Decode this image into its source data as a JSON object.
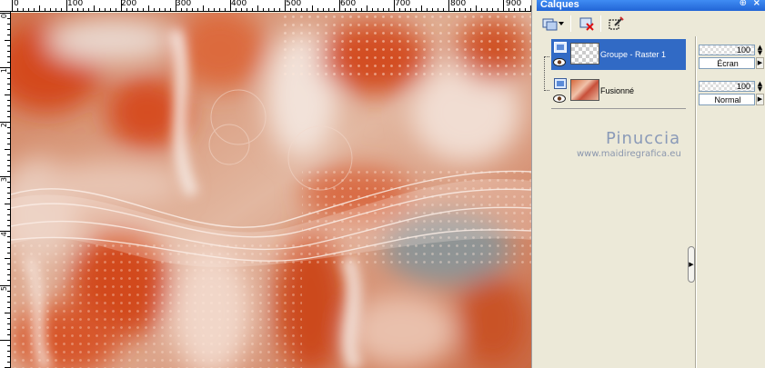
{
  "ruler": {
    "top_ticks": [
      "0",
      "100",
      "200",
      "300",
      "400",
      "500",
      "600",
      "700",
      "800",
      "900"
    ],
    "left_ticks": [
      "0",
      "1",
      "2",
      "3",
      "4",
      "5"
    ]
  },
  "panel": {
    "title": "Calques",
    "pin_glyph": "⊕",
    "close_glyph": "×"
  },
  "toolbar": {
    "icons": [
      "new-layer-icon",
      "dropdown-arrow-icon",
      "delete-layer-icon",
      "edit-selection-icon"
    ]
  },
  "layers": [
    {
      "name": "Groupe - Raster 1",
      "selected": true,
      "thumbnail": "transparent",
      "opacity": "100",
      "blend_mode": "Écran"
    },
    {
      "name": "Fusionné",
      "selected": false,
      "thumbnail": "image",
      "opacity": "100",
      "blend_mode": "Normal"
    }
  ],
  "watermark": {
    "title": "Pinuccia",
    "url": "www.maidiregrafica.eu"
  },
  "colors": {
    "selection": "#316ac5",
    "titlebar": "#2265d6",
    "panel_bg": "#ece9d8",
    "canvas_orange": "#d8582a"
  }
}
